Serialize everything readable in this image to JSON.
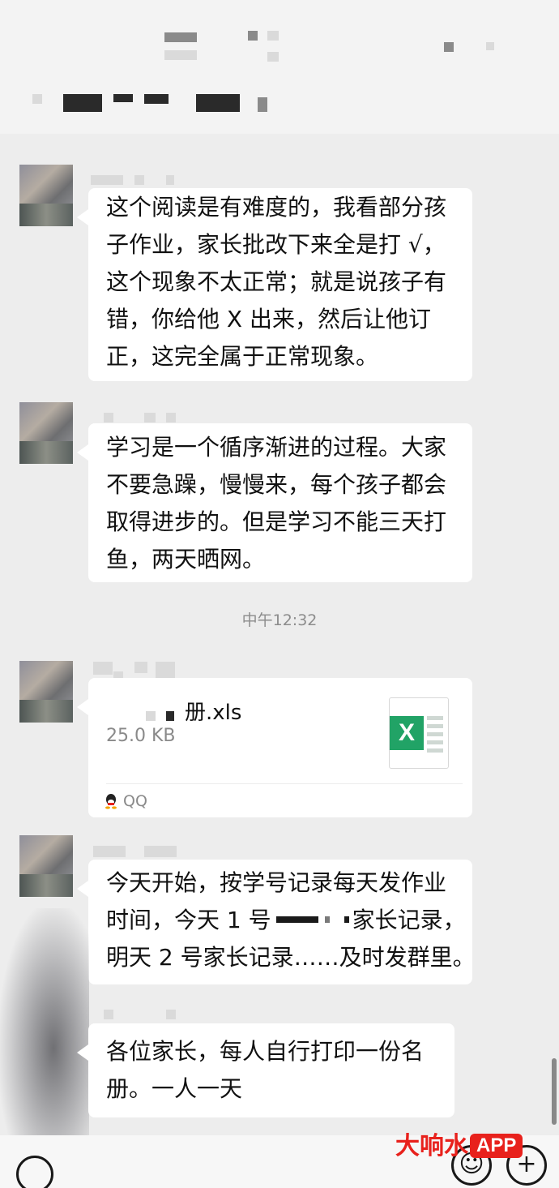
{
  "messages": [
    {
      "lines": [
        "这个阅读是有难度的，我看部分孩",
        "子作业，家长批改下来全是打 √，",
        "这个现象不太正常；就是说孩子有",
        "错，你给他 X 出来，然后让他订",
        "正，这完全属于正常现象。"
      ]
    },
    {
      "lines": [
        "学习是一个循序渐进的过程。大家",
        "不要急躁，慢慢来，每个孩子都会",
        "取得进步的。但是学习不能三天打",
        "鱼，两天晒网。"
      ]
    },
    {
      "lines": [
        "今天开始，按学号记录每天发作业",
        "时间，今天 1 号",
        "家长记录，",
        "明天 2 号家长记录……及时发群里。"
      ]
    },
    {
      "lines": [
        "各位家长，每人自行打印一份名",
        "册。一人一天"
      ]
    }
  ],
  "timestamp": "中午12:32",
  "file": {
    "name": "册.xls",
    "size": "25.0 KB",
    "source": "QQ",
    "icon": "excel-icon",
    "icon_letter": "X"
  },
  "bottom_bar": {
    "emoji_icon": "emoji-icon",
    "emoji_glyph": "☺",
    "add_icon": "plus-icon",
    "add_glyph": "+"
  },
  "watermark": {
    "brand": "大响水",
    "app": "APP"
  },
  "colors": {
    "background": "#ededed",
    "bubble": "#ffffff",
    "excel_green": "#21a366",
    "watermark_red": "#e8211c"
  }
}
